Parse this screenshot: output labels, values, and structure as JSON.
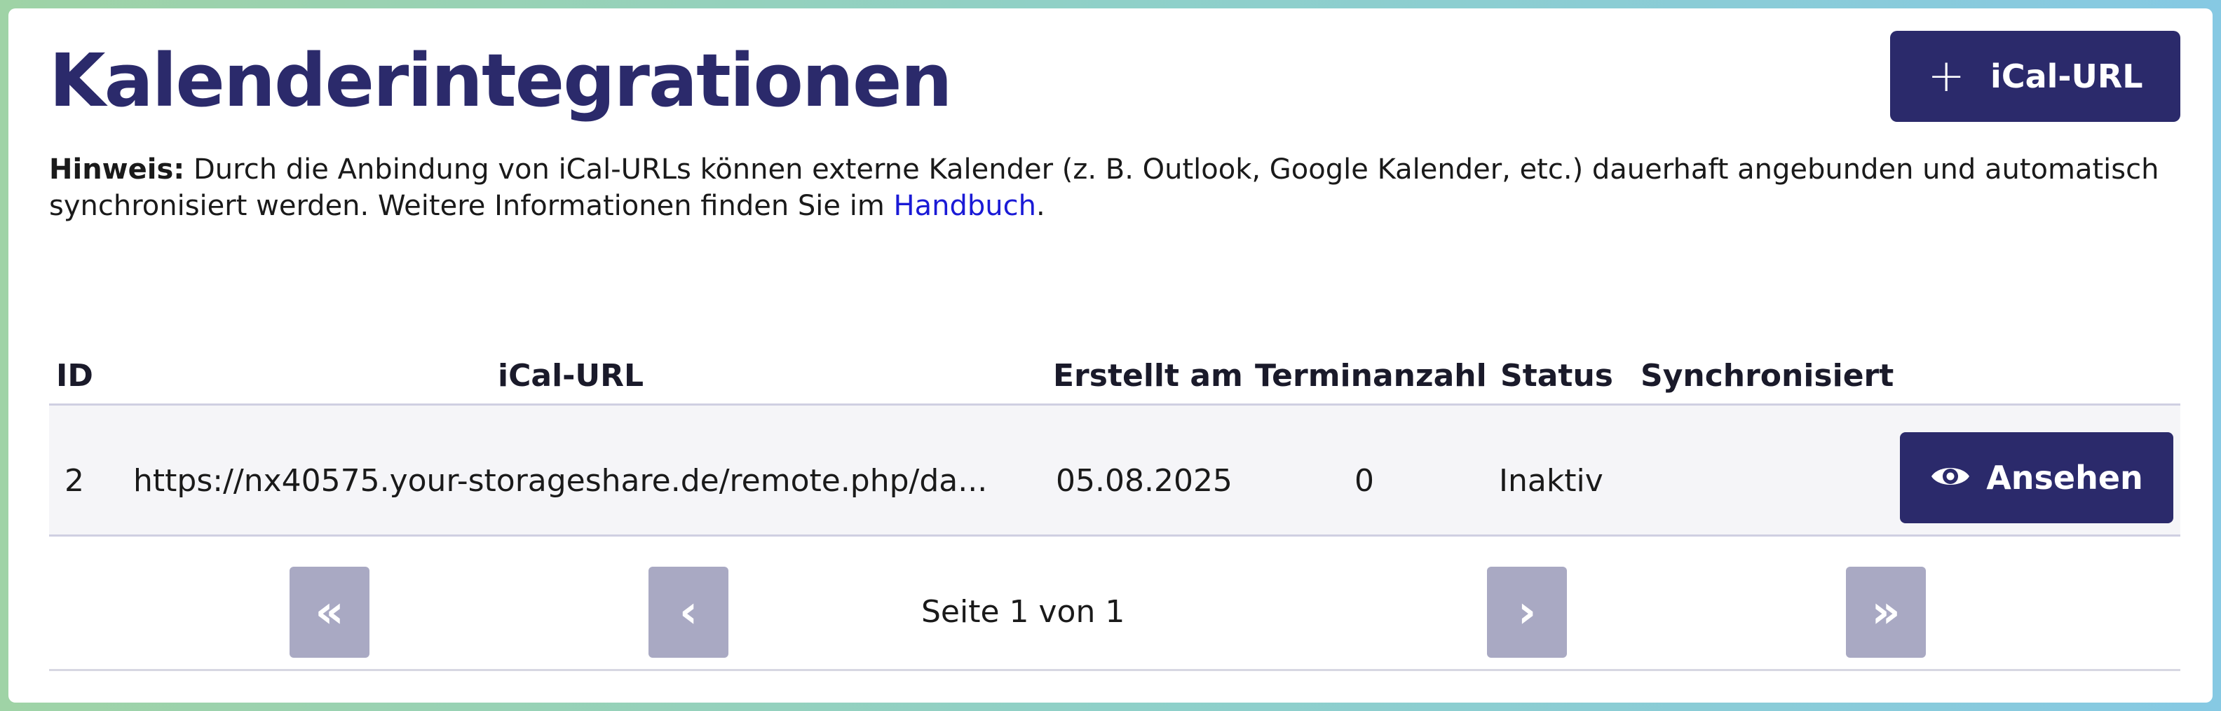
{
  "page": {
    "title": "Kalenderintegrationen",
    "add_button_label": "iCal-URL",
    "add_button_icon": "plus-icon"
  },
  "hint": {
    "label": "Hinweis:",
    "text": " Durch die Anbindung von iCal-URLs können externe Kalender (z. B. Outlook, Google Kalender, etc.) dauerhaft angebunden und automatisch synchronisiert werden. Weitere Informationen finden Sie im ",
    "link": "Handbuch",
    "end": "."
  },
  "table": {
    "columns": [
      "ID",
      "iCal-URL",
      "Erstellt am",
      "Terminanzahl",
      "Status",
      "Synchronisiert"
    ],
    "rows": [
      {
        "id": "2",
        "url": "https://nx40575.your-storageshare.de/remote.php/da...",
        "created": "05.08.2025",
        "count": "0",
        "status": "Inaktiv",
        "synced": "",
        "action_label": "Ansehen",
        "action_icon": "eye-icon"
      }
    ]
  },
  "pagination": {
    "label": "Seite 1 von 1",
    "first": "«",
    "prev": "‹",
    "next": "›",
    "last": "»"
  },
  "colors": {
    "brand": "#2b2a6b",
    "link": "#1a1ad6",
    "disabled_button": "#a9a9c3",
    "row_background": "#f5f5f8"
  }
}
